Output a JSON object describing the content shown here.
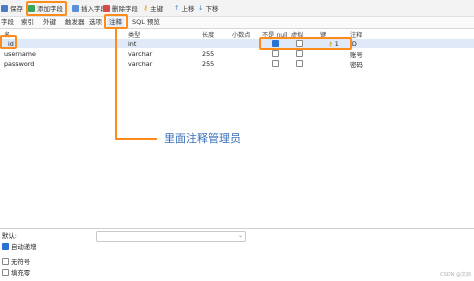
{
  "toolbar": {
    "save_label": "保存",
    "add_field_label": "添加字段",
    "insert_field_label": "插入字段",
    "delete_field_label": "删除字段",
    "primary_key_label": "主键",
    "move_up_label": "上移",
    "move_down_label": "下移"
  },
  "tabs": [
    "字段",
    "索引",
    "外键",
    "触发器",
    "选项",
    "注释",
    "SQL 预览"
  ],
  "active_tab": "注释",
  "columns": [
    "名",
    "类型",
    "长度",
    "小数点",
    "不是 null",
    "虚拟",
    "键",
    "注释"
  ],
  "rows": [
    {
      "name": "id",
      "type": "int",
      "length": "",
      "decimals": "",
      "not_null": true,
      "virtual": false,
      "key": "1",
      "comment": "ID"
    },
    {
      "name": "username",
      "type": "varchar",
      "length": "255",
      "decimals": "",
      "not_null": false,
      "virtual": false,
      "key": "",
      "comment": "账号"
    },
    {
      "name": "password",
      "type": "varchar",
      "length": "255",
      "decimals": "",
      "not_null": false,
      "virtual": false,
      "key": "",
      "comment": "密码"
    }
  ],
  "annotation": "里面注释管理员",
  "bottom": {
    "default_label": "默认:",
    "auto_increment_label": "自动递增",
    "unsigned_label": "无符号",
    "zerofill_label": "填充零"
  },
  "watermark": "CSDN @文启",
  "colors": {
    "accent": "#ff8c1a",
    "selected_row": "#dfe9f7",
    "annotation": "#3a6fb5"
  }
}
